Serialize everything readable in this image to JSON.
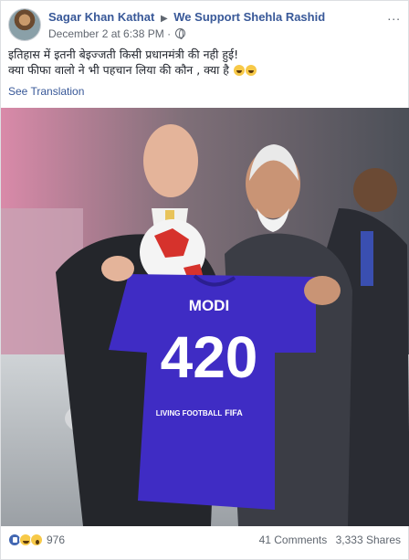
{
  "post": {
    "author": "Sagar Khan Kathat",
    "target": "We Support Shehla Rashid",
    "timestamp": "December 2 at 6:38 PM",
    "more_label": "...",
    "text_line1": "इतिहास में इतनी बेइज्जती किसी प्रधानमंत्री की नही हुई!",
    "text_line2": "क्या फीफा वालो ने भी पहचान लिया की कौन , क्या है",
    "see_translation": "See Translation"
  },
  "photo": {
    "jersey_name": "MODI",
    "jersey_number": "420",
    "jersey_text": "LIVING FOOTBALL",
    "jersey_brand": "FIFA"
  },
  "footer": {
    "reaction_count": "976",
    "comments": "41 Comments",
    "shares": "3,333 Shares"
  },
  "colors": {
    "link_blue": "#385898",
    "meta_gray": "#616770",
    "jersey_blue": "#3f2cc4"
  },
  "icons": [
    "avatar",
    "globe-icon",
    "more-icon",
    "grin-emoji-icon",
    "like-reaction-icon",
    "haha-reaction-icon",
    "wow-reaction-icon"
  ]
}
